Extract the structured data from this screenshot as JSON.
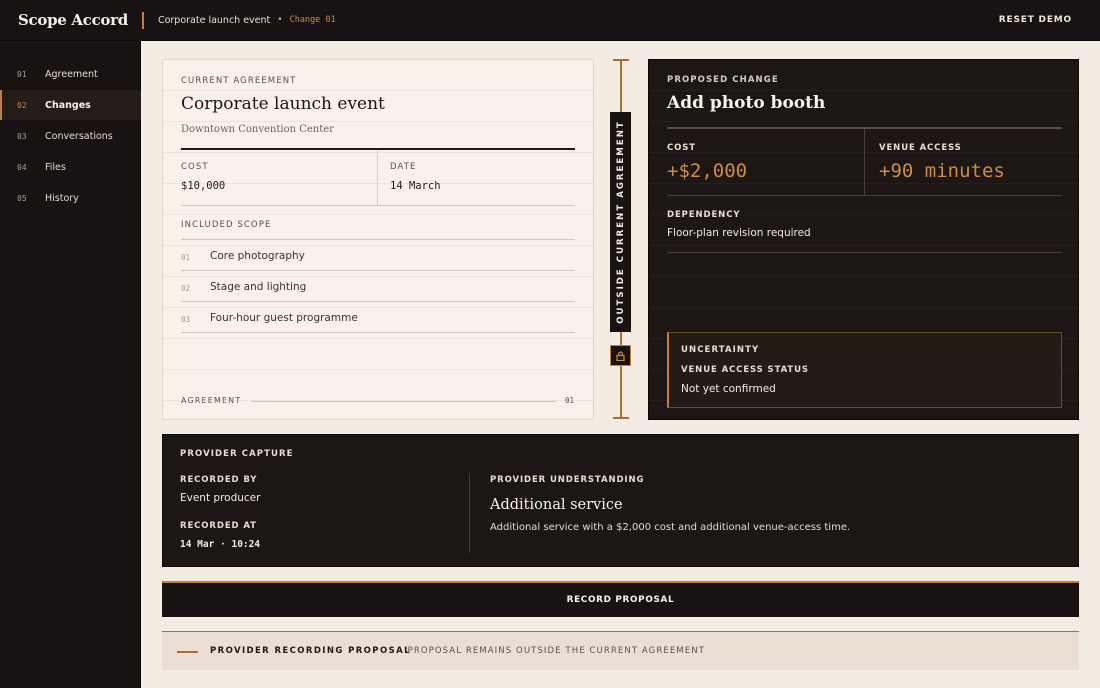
{
  "header": {
    "brand": "Scope Accord",
    "crumb_title": "Corporate launch event",
    "crumb_separator": "•",
    "crumb_change": "Change 01",
    "reset_label": "RESET DEMO"
  },
  "sidebar": {
    "items": [
      {
        "num": "01",
        "label": "Agreement",
        "active": false
      },
      {
        "num": "02",
        "label": "Changes",
        "active": true
      },
      {
        "num": "03",
        "label": "Conversations",
        "active": false
      },
      {
        "num": "04",
        "label": "Files",
        "active": false
      },
      {
        "num": "05",
        "label": "History",
        "active": false
      }
    ]
  },
  "agreement": {
    "section_label": "CURRENT AGREEMENT",
    "title": "Corporate launch event",
    "venue": "Downtown Convention Center",
    "cost_label": "COST",
    "cost_value": "$10,000",
    "date_label": "DATE",
    "date_value": "14 March",
    "scope_label": "INCLUDED SCOPE",
    "scope_items": [
      {
        "num": "01",
        "text": "Core photography"
      },
      {
        "num": "02",
        "text": "Stage and lighting"
      },
      {
        "num": "03",
        "text": "Four-hour guest programme"
      }
    ],
    "footer_label": "AGREEMENT",
    "footer_num": "01"
  },
  "rail": {
    "badge_text": "OUTSIDE CURRENT AGREEMENT",
    "lock_icon": "lock-icon"
  },
  "proposed": {
    "section_label": "PROPOSED CHANGE",
    "title": "Add photo booth",
    "cost_label": "COST",
    "cost_value": "+$2,000",
    "access_label": "VENUE ACCESS",
    "access_value": "+90 minutes",
    "dependency_label": "DEPENDENCY",
    "dependency_value": "Floor-plan revision required",
    "uncertainty_title": "UNCERTAINTY",
    "uncertainty_label": "VENUE ACCESS STATUS",
    "uncertainty_value": "Not yet confirmed"
  },
  "capture": {
    "section_label": "PROVIDER CAPTURE",
    "recorded_by_label": "RECORDED BY",
    "recorded_by_value": "Event producer",
    "recorded_at_label": "RECORDED AT",
    "recorded_at_value": "14 Mar · 10:24",
    "understanding_label": "PROVIDER UNDERSTANDING",
    "understanding_title": "Additional service",
    "understanding_desc": "Additional service with a $2,000 cost and additional venue-access time."
  },
  "action": {
    "record_label": "RECORD PROPOSAL"
  },
  "status": {
    "strong": "PROVIDER RECORDING PROPOSAL",
    "rest": "· PROPOSAL REMAINS OUTSIDE THE CURRENT AGREEMENT"
  },
  "colors": {
    "accent": "#c97f33",
    "dark": "#181312",
    "paper": "#f8f2ea"
  }
}
